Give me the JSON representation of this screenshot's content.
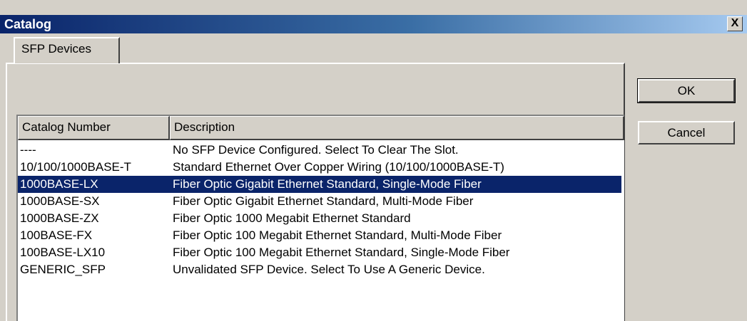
{
  "window": {
    "title": "Catalog",
    "close_label": "X"
  },
  "tabs": [
    {
      "label": "SFP Devices"
    }
  ],
  "buttons": {
    "ok_label": "OK",
    "cancel_label": "Cancel"
  },
  "table": {
    "columns": [
      "Catalog Number",
      "Description"
    ],
    "selected_row": 2,
    "rows": [
      {
        "catalog_number": "----",
        "description": "No SFP Device Configured.  Select To Clear The Slot."
      },
      {
        "catalog_number": "10/100/1000BASE-T",
        "description": "Standard Ethernet Over Copper Wiring (10/100/1000BASE-T)"
      },
      {
        "catalog_number": "1000BASE-LX",
        "description": "Fiber Optic Gigabit Ethernet Standard, Single-Mode Fiber"
      },
      {
        "catalog_number": "1000BASE-SX",
        "description": "Fiber Optic Gigabit Ethernet Standard, Multi-Mode Fiber"
      },
      {
        "catalog_number": "1000BASE-ZX",
        "description": "Fiber Optic 1000 Megabit Ethernet Standard"
      },
      {
        "catalog_number": "100BASE-FX",
        "description": "Fiber Optic 100 Megabit Ethernet Standard, Multi-Mode Fiber"
      },
      {
        "catalog_number": "100BASE-LX10",
        "description": "Fiber Optic 100 Megabit Ethernet Standard, Single-Mode Fiber"
      },
      {
        "catalog_number": "GENERIC_SFP",
        "description": "Unvalidated SFP Device.  Select To Use A Generic Device."
      }
    ]
  },
  "colors": {
    "title_gradient_start": "#0a246a",
    "title_gradient_end": "#a6caf0",
    "selection": "#0a246a",
    "face": "#d4d0c8"
  }
}
